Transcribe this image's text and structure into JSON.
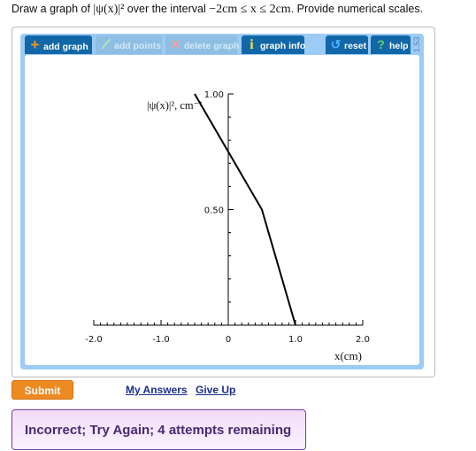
{
  "question": {
    "prefix": "Draw a graph of ",
    "func": "|ψ(x)|²",
    "middle": " over the interval ",
    "interval": "−2cm ≤ x ≤ 2cm",
    "suffix": ". Provide numerical scales."
  },
  "toolbar": {
    "add_graph": {
      "label": "add graph",
      "icon": "plus-icon",
      "enabled": true
    },
    "add_points": {
      "label": "add points",
      "icon": "points-icon",
      "enabled": false
    },
    "delete_graph": {
      "label": "delete graph",
      "icon": "x-icon",
      "enabled": false
    },
    "graph_info": {
      "label": "graph info",
      "icon": "info-icon",
      "enabled": true
    },
    "reset": {
      "label": "reset",
      "icon": "reset-icon"
    },
    "help": {
      "label": "help",
      "icon": "question-icon"
    },
    "version": "1.53"
  },
  "chart_data": {
    "type": "line",
    "ylabel": "|ψ(x)|², cm⁻¹",
    "xlabel": "x(cm)",
    "xlim": [
      -2,
      2
    ],
    "ylim": [
      0,
      1
    ],
    "x_ticks": [
      "-2.0",
      "-1.0",
      "0",
      "1.0",
      "2.0"
    ],
    "y_ticks": [
      "0.50",
      "1.00"
    ],
    "series": [
      {
        "points": [
          [
            -0.5,
            1.0
          ],
          [
            0,
            0.75
          ],
          [
            0.5,
            0.5
          ],
          [
            1.0,
            0
          ]
        ]
      }
    ],
    "color": "#000000"
  },
  "actions": {
    "submit": "Submit",
    "my_answers": "My Answers",
    "give_up": "Give Up"
  },
  "feedback": "Incorrect; Try Again; 4 attempts remaining",
  "colors": {
    "toolbar": "#1267a8",
    "panel": "#9ccbf5",
    "submit": "#ee8a22",
    "feedback_border": "#7a3a96"
  }
}
